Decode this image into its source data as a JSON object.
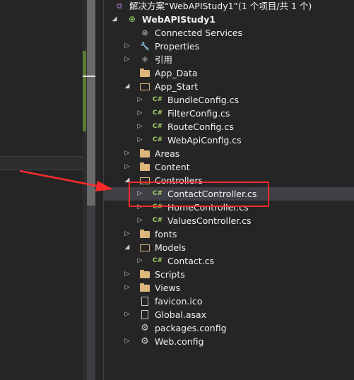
{
  "solution": {
    "title": "解决方案“WebAPIStudy1”(1 个项目/共 1 个)",
    "project": "WebAPIStudy1"
  },
  "tree": [
    {
      "label": "Connected Services",
      "icon": "connected-services-icon"
    },
    {
      "label": "Properties",
      "icon": "wrench-icon"
    },
    {
      "label": "引用",
      "icon": "references-icon"
    },
    {
      "label": "App_Data",
      "icon": "folder-icon"
    },
    {
      "label": "App_Start",
      "icon": "folder-open-icon"
    },
    {
      "label": "BundleConfig.cs",
      "icon": "csharp-file-icon"
    },
    {
      "label": "FilterConfig.cs",
      "icon": "csharp-file-icon"
    },
    {
      "label": "RouteConfig.cs",
      "icon": "csharp-file-icon"
    },
    {
      "label": "WebApiConfig.cs",
      "icon": "csharp-file-icon"
    },
    {
      "label": "Areas",
      "icon": "folder-icon"
    },
    {
      "label": "Content",
      "icon": "folder-icon"
    },
    {
      "label": "Controllers",
      "icon": "folder-open-icon"
    },
    {
      "label": "ContactController.cs",
      "icon": "csharp-file-icon"
    },
    {
      "label": "HomeController.cs",
      "icon": "csharp-file-icon"
    },
    {
      "label": "ValuesController.cs",
      "icon": "csharp-file-icon"
    },
    {
      "label": "fonts",
      "icon": "folder-icon"
    },
    {
      "label": "Models",
      "icon": "folder-open-icon"
    },
    {
      "label": "Contact.cs",
      "icon": "csharp-file-icon"
    },
    {
      "label": "Scripts",
      "icon": "folder-icon"
    },
    {
      "label": "Views",
      "icon": "folder-icon"
    },
    {
      "label": "favicon.ico",
      "icon": "file-icon"
    },
    {
      "label": "Global.asax",
      "icon": "file-icon"
    },
    {
      "label": "packages.config",
      "icon": "config-file-icon"
    },
    {
      "label": "Web.config",
      "icon": "config-file-icon"
    }
  ],
  "icons": {
    "csharp": "C#"
  },
  "colors": {
    "background": "#252526",
    "selected_row": "#3f3f46",
    "folder": "#dcb67a",
    "csharp": "#9ccc65",
    "annotation": "#ff2a2a"
  }
}
